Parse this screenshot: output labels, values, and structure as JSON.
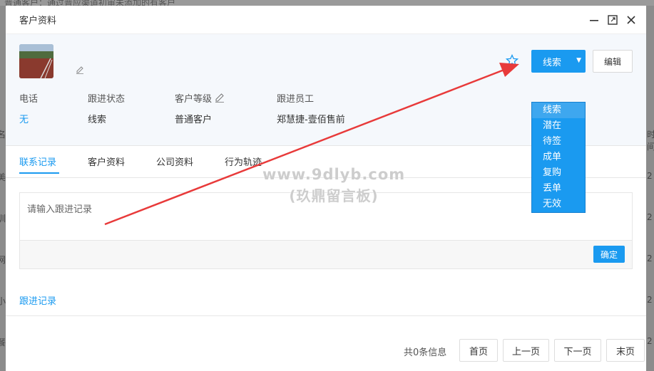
{
  "background": {
    "top_text": "普通客户：通过普应渠道初审未添加的有客户",
    "left_fragments": [
      "名",
      "美",
      "训",
      "网",
      "小",
      "餐"
    ],
    "right_fragments": [
      "时间",
      "2",
      "2",
      "2",
      "2",
      "2"
    ]
  },
  "modal": {
    "title": "客户资料",
    "status_button": "线索",
    "edit_button": "编辑",
    "fields": [
      {
        "label": "电话",
        "value": "无"
      },
      {
        "label": "跟进状态",
        "value": "线索"
      },
      {
        "label": "客户等级",
        "value": "普通客户"
      },
      {
        "label": "跟进员工",
        "value": "郑慧捷-壹佰售前"
      }
    ],
    "status_options": [
      "线索",
      "潜在",
      "待签",
      "成单",
      "复购",
      "丢单",
      "无效"
    ],
    "tabs": [
      "联系记录",
      "客户资料",
      "公司资料",
      "行为轨迹"
    ],
    "record_placeholder": "请输入跟进记录",
    "confirm_button": "确定",
    "follow_title": "跟进记录",
    "pager": {
      "info": "共0条信息",
      "first": "首页",
      "prev": "上一页",
      "next": "下一页",
      "last": "末页"
    }
  },
  "watermark": {
    "line1": "www.9dlyb.com",
    "line2": "(玖鼎留言板)"
  },
  "colors": {
    "accent": "#1a9af0",
    "arrow": "#e83a3a",
    "panel_bg": "#f5f8fc"
  }
}
